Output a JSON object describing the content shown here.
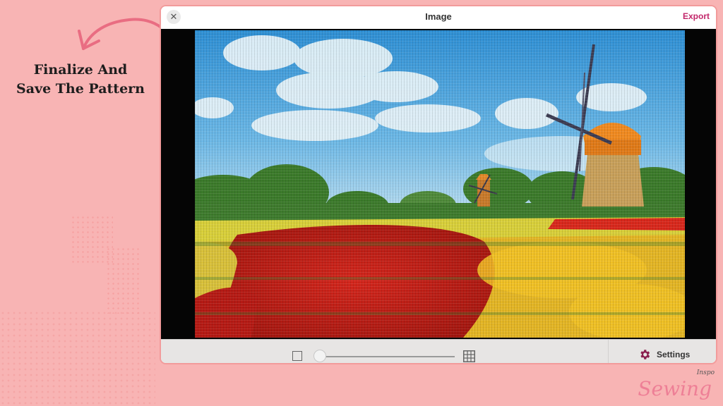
{
  "caption": {
    "line1": "Finalize And",
    "line2": "Save The Pattern"
  },
  "window": {
    "title": "Image",
    "export_label": "Export",
    "close_label": "✕"
  },
  "toolbar": {
    "settings_label": "Settings",
    "zoom_level": 0.0
  },
  "brand": {
    "main": "Sewing",
    "small": "Inspo"
  },
  "colors": {
    "background": "#f8b4b4",
    "accent": "#c2266a",
    "brand": "#ee7f96"
  },
  "icons": [
    "close-icon",
    "zoom-min-icon",
    "grid-icon",
    "gear-icon",
    "curved-arrow-icon"
  ]
}
